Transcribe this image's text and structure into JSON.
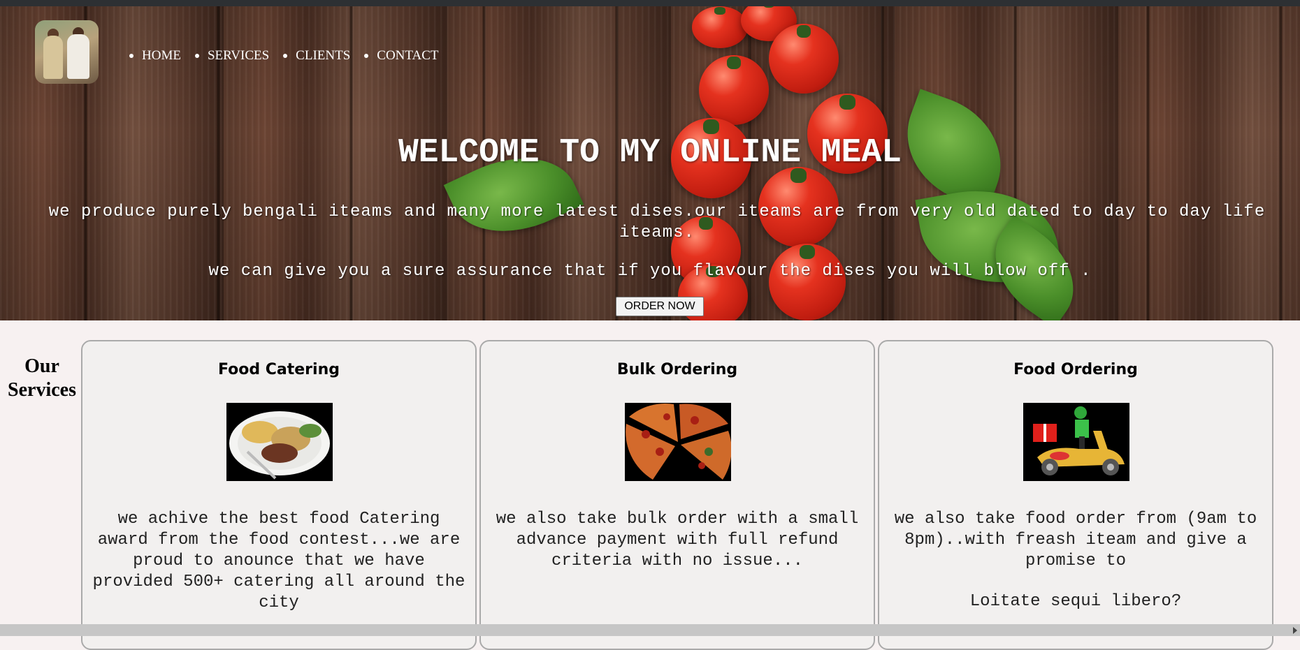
{
  "nav": {
    "items": [
      {
        "label": "HOME"
      },
      {
        "label": "SERVICES"
      },
      {
        "label": "CLIENTS"
      },
      {
        "label": "CONTACT"
      }
    ]
  },
  "hero": {
    "title": "WELCOME TO MY ONLINE MEAL",
    "text1": "we produce purely bengali iteams and many more latest dises.our iteams are from very old dated to day to day life iteams.",
    "text2": "we can give you a sure assurance that if you flavour the dises you will blow off .",
    "button_label": "ORDER NOW"
  },
  "services": {
    "heading": "Our Services",
    "cards": [
      {
        "title": "Food Catering",
        "image": "plate-food-image",
        "text": "we achive the best food Catering award from the food contest...we are proud to anounce that we have provided 500+ catering all around the city",
        "text2": ""
      },
      {
        "title": "Bulk Ordering",
        "image": "pizza-slices-image",
        "text": "we also take bulk order with a small advance payment with full refund criteria with no issue...",
        "text2": ""
      },
      {
        "title": "Food Ordering",
        "image": "delivery-scooter-image",
        "text": "we also take food order from (9am to 8pm)..with freash iteam and give a promise to",
        "text2": "Loitate sequi libero?"
      }
    ]
  },
  "colors": {
    "card_border": "#aaaaaa",
    "page_bg": "#f7f1f1",
    "hero_wood": "#5a3a2c"
  }
}
